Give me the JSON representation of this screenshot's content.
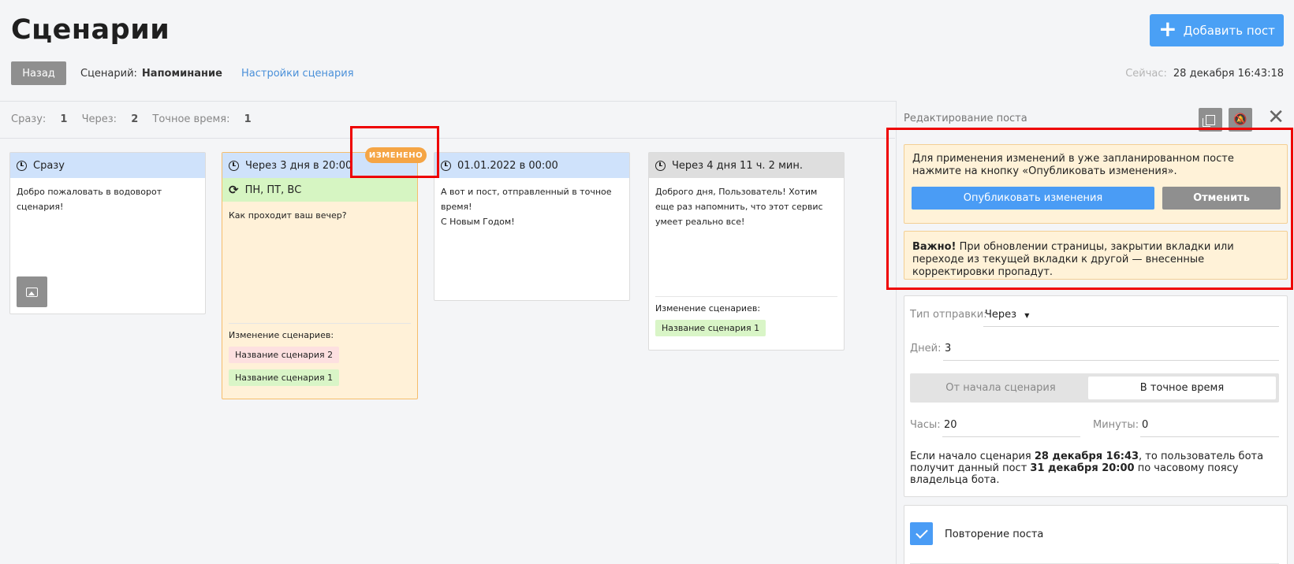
{
  "header": {
    "title": "Сценарии",
    "add_post_label": "Добавить пост",
    "back_label": "Назад",
    "scenario_prefix": "Сценарий:",
    "scenario_name": "Напоминание",
    "settings_link": "Настройки сценария",
    "now_label": "Сейчас:",
    "now_value": "28 декабря 16:43:18"
  },
  "stats": {
    "immediately_label": "Сразу:",
    "immediately_count": "1",
    "after_label": "Через:",
    "after_count": "2",
    "exact_label": "Точное время:",
    "exact_count": "1"
  },
  "badge": "ИЗМЕНЕНО",
  "cards": [
    {
      "header": "Сразу",
      "text": "Добро пожаловать в водоворот сценария!"
    },
    {
      "header": "Через 3 дня в 20:00",
      "repeat": "ПН, ПТ, ВС",
      "text": "Как проходит ваш вечер?",
      "scenario_change_label": "Изменение сценариев:",
      "tags": [
        "Название сценария 2",
        "Название сценария 1"
      ]
    },
    {
      "header": "01.01.2022 в 00:00",
      "text_lines": [
        "А вот и пост, отправленный в точное время!",
        "С Новым Годом!"
      ]
    },
    {
      "header": "Через 4 дня 11 ч. 2 мин.",
      "text": "Доброго дня, Пользователь! Хотим еще раз напомнить, что этот сервис умеет реально все!",
      "scenario_change_label": "Изменение сценариев:",
      "tags": [
        "Название сценария 1"
      ]
    }
  ],
  "panel": {
    "title": "Редактирование поста",
    "notice1": "Для применения изменений в уже запланированном посте нажмите на кнопку «Опубликовать изменения».",
    "publish_label": "Опубликовать изменения",
    "cancel_label": "Отменить",
    "notice2_bold": "Важно!",
    "notice2_text": " При обновлении страницы, закрытии вкладки или переходе из текущей вкладки к другой — внесенные корректировки пропадут.",
    "send_type_label": "Тип отправки:",
    "send_type_value": "Через",
    "days_label": "Дней:",
    "days_value": "3",
    "mode_option_1": "От начала сценария",
    "mode_option_2": "В точное время",
    "hours_label": "Часы:",
    "hours_value": "20",
    "minutes_label": "Минуты:",
    "minutes_value": "0",
    "info_1": "Если начало сценария ",
    "info_bold_1": "28 декабря 16:43",
    "info_2": ", то пользователь бота получит данный пост ",
    "info_bold_2": "31 декабря 20:00",
    "info_3": " по часовому поясу владельца бота.",
    "repeat_label": "Повторение поста"
  },
  "colors": {
    "accent_blue": "#4a9cf5",
    "card_header_blue": "#cfe2fb",
    "changed_orange": "#f5a545",
    "highlight_red": "#ee0000"
  }
}
